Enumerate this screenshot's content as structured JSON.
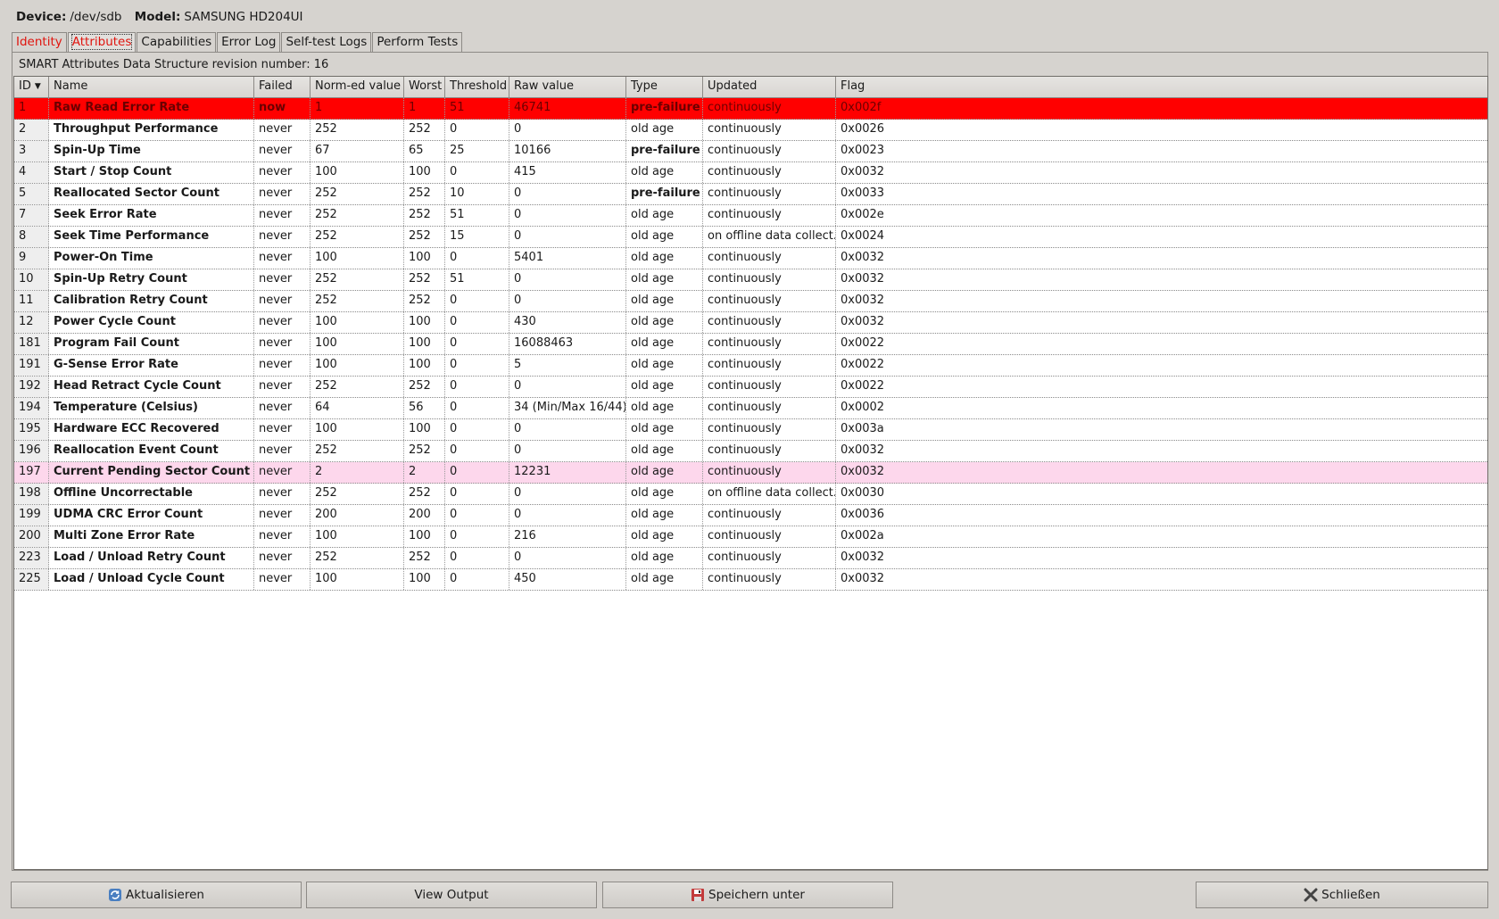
{
  "header": {
    "device_label": "Device:",
    "device_value": "/dev/sdb",
    "model_label": "Model:",
    "model_value": "SAMSUNG HD204UI"
  },
  "tabs": [
    {
      "label": "Identity",
      "state": "warning"
    },
    {
      "label": "Attributes",
      "state": "active-warning"
    },
    {
      "label": "Capabilities",
      "state": "normal"
    },
    {
      "label": "Error Log",
      "state": "normal"
    },
    {
      "label": "Self-test Logs",
      "state": "normal"
    },
    {
      "label": "Perform Tests",
      "state": "normal"
    }
  ],
  "revision_text": "SMART Attributes Data Structure revision number: 16",
  "table": {
    "columns": [
      "ID",
      "Name",
      "Failed",
      "Norm-ed value",
      "Worst",
      "Threshold",
      "Raw value",
      "Type",
      "Updated",
      "Flag"
    ],
    "sort_column": "ID",
    "rows": [
      {
        "id": "1",
        "name": "Raw Read Error Rate",
        "failed": "now",
        "norm": "1",
        "worst": "1",
        "threshold": "51",
        "raw": "46741",
        "type": "pre-failure",
        "updated": "continuously",
        "flag": "0x002f",
        "status": "failing"
      },
      {
        "id": "2",
        "name": "Throughput Performance",
        "failed": "never",
        "norm": "252",
        "worst": "252",
        "threshold": "0",
        "raw": "0",
        "type": "old age",
        "updated": "continuously",
        "flag": "0x0026",
        "status": "ok"
      },
      {
        "id": "3",
        "name": "Spin-Up Time",
        "failed": "never",
        "norm": "67",
        "worst": "65",
        "threshold": "25",
        "raw": "10166",
        "type": "pre-failure",
        "updated": "continuously",
        "flag": "0x0023",
        "status": "ok"
      },
      {
        "id": "4",
        "name": "Start / Stop Count",
        "failed": "never",
        "norm": "100",
        "worst": "100",
        "threshold": "0",
        "raw": "415",
        "type": "old age",
        "updated": "continuously",
        "flag": "0x0032",
        "status": "ok"
      },
      {
        "id": "5",
        "name": "Reallocated Sector Count",
        "failed": "never",
        "norm": "252",
        "worst": "252",
        "threshold": "10",
        "raw": "0",
        "type": "pre-failure",
        "updated": "continuously",
        "flag": "0x0033",
        "status": "ok"
      },
      {
        "id": "7",
        "name": "Seek Error Rate",
        "failed": "never",
        "norm": "252",
        "worst": "252",
        "threshold": "51",
        "raw": "0",
        "type": "old age",
        "updated": "continuously",
        "flag": "0x002e",
        "status": "ok"
      },
      {
        "id": "8",
        "name": "Seek Time Performance",
        "failed": "never",
        "norm": "252",
        "worst": "252",
        "threshold": "15",
        "raw": "0",
        "type": "old age",
        "updated": "on offline data collect.",
        "flag": "0x0024",
        "status": "ok"
      },
      {
        "id": "9",
        "name": "Power-On Time",
        "failed": "never",
        "norm": "100",
        "worst": "100",
        "threshold": "0",
        "raw": "5401",
        "type": "old age",
        "updated": "continuously",
        "flag": "0x0032",
        "status": "ok"
      },
      {
        "id": "10",
        "name": "Spin-Up Retry Count",
        "failed": "never",
        "norm": "252",
        "worst": "252",
        "threshold": "51",
        "raw": "0",
        "type": "old age",
        "updated": "continuously",
        "flag": "0x0032",
        "status": "ok"
      },
      {
        "id": "11",
        "name": "Calibration Retry Count",
        "failed": "never",
        "norm": "252",
        "worst": "252",
        "threshold": "0",
        "raw": "0",
        "type": "old age",
        "updated": "continuously",
        "flag": "0x0032",
        "status": "ok"
      },
      {
        "id": "12",
        "name": "Power Cycle Count",
        "failed": "never",
        "norm": "100",
        "worst": "100",
        "threshold": "0",
        "raw": "430",
        "type": "old age",
        "updated": "continuously",
        "flag": "0x0032",
        "status": "ok"
      },
      {
        "id": "181",
        "name": "Program Fail Count",
        "failed": "never",
        "norm": "100",
        "worst": "100",
        "threshold": "0",
        "raw": "16088463",
        "type": "old age",
        "updated": "continuously",
        "flag": "0x0022",
        "status": "ok"
      },
      {
        "id": "191",
        "name": "G-Sense Error Rate",
        "failed": "never",
        "norm": "100",
        "worst": "100",
        "threshold": "0",
        "raw": "5",
        "type": "old age",
        "updated": "continuously",
        "flag": "0x0022",
        "status": "ok"
      },
      {
        "id": "192",
        "name": "Head Retract Cycle Count",
        "failed": "never",
        "norm": "252",
        "worst": "252",
        "threshold": "0",
        "raw": "0",
        "type": "old age",
        "updated": "continuously",
        "flag": "0x0022",
        "status": "ok"
      },
      {
        "id": "194",
        "name": "Temperature (Celsius)",
        "failed": "never",
        "norm": "64",
        "worst": "56",
        "threshold": "0",
        "raw": "34 (Min/Max 16/44)",
        "type": "old age",
        "updated": "continuously",
        "flag": "0x0002",
        "status": "ok"
      },
      {
        "id": "195",
        "name": "Hardware ECC Recovered",
        "failed": "never",
        "norm": "100",
        "worst": "100",
        "threshold": "0",
        "raw": "0",
        "type": "old age",
        "updated": "continuously",
        "flag": "0x003a",
        "status": "ok"
      },
      {
        "id": "196",
        "name": "Reallocation Event Count",
        "failed": "never",
        "norm": "252",
        "worst": "252",
        "threshold": "0",
        "raw": "0",
        "type": "old age",
        "updated": "continuously",
        "flag": "0x0032",
        "status": "ok"
      },
      {
        "id": "197",
        "name": "Current Pending Sector Count",
        "failed": "never",
        "norm": "2",
        "worst": "2",
        "threshold": "0",
        "raw": "12231",
        "type": "old age",
        "updated": "continuously",
        "flag": "0x0032",
        "status": "warning"
      },
      {
        "id": "198",
        "name": "Offline Uncorrectable",
        "failed": "never",
        "norm": "252",
        "worst": "252",
        "threshold": "0",
        "raw": "0",
        "type": "old age",
        "updated": "on offline data collect.",
        "flag": "0x0030",
        "status": "ok"
      },
      {
        "id": "199",
        "name": "UDMA CRC Error Count",
        "failed": "never",
        "norm": "200",
        "worst": "200",
        "threshold": "0",
        "raw": "0",
        "type": "old age",
        "updated": "continuously",
        "flag": "0x0036",
        "status": "ok"
      },
      {
        "id": "200",
        "name": "Multi Zone Error Rate",
        "failed": "never",
        "norm": "100",
        "worst": "100",
        "threshold": "0",
        "raw": "216",
        "type": "old age",
        "updated": "continuously",
        "flag": "0x002a",
        "status": "ok"
      },
      {
        "id": "223",
        "name": "Load / Unload Retry Count",
        "failed": "never",
        "norm": "252",
        "worst": "252",
        "threshold": "0",
        "raw": "0",
        "type": "old age",
        "updated": "continuously",
        "flag": "0x0032",
        "status": "ok"
      },
      {
        "id": "225",
        "name": "Load / Unload Cycle Count",
        "failed": "never",
        "norm": "100",
        "worst": "100",
        "threshold": "0",
        "raw": "450",
        "type": "old age",
        "updated": "continuously",
        "flag": "0x0032",
        "status": "ok"
      }
    ]
  },
  "buttons": {
    "refresh": {
      "label": "Aktualisieren",
      "icon": "refresh-icon"
    },
    "view_output": {
      "label": "View Output"
    },
    "save_as": {
      "label": "Speichern unter",
      "icon": "save-icon"
    },
    "close": {
      "label": "Schließen",
      "icon": "close-icon"
    }
  },
  "colors": {
    "failing_row": "#ff0000",
    "warning_row": "#fdd7ec",
    "warning_tab_text": "#e0140e"
  }
}
